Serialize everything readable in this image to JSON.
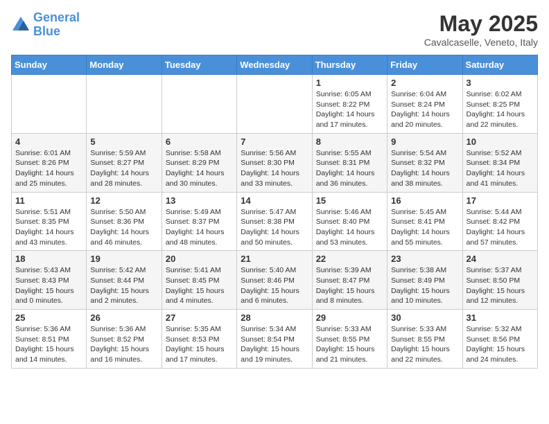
{
  "logo": {
    "line1": "General",
    "line2": "Blue"
  },
  "title": "May 2025",
  "location": "Cavalcaselle, Veneto, Italy",
  "weekdays": [
    "Sunday",
    "Monday",
    "Tuesday",
    "Wednesday",
    "Thursday",
    "Friday",
    "Saturday"
  ],
  "weeks": [
    [
      {
        "day": "",
        "info": ""
      },
      {
        "day": "",
        "info": ""
      },
      {
        "day": "",
        "info": ""
      },
      {
        "day": "",
        "info": ""
      },
      {
        "day": "1",
        "info": "Sunrise: 6:05 AM\nSunset: 8:22 PM\nDaylight: 14 hours\nand 17 minutes."
      },
      {
        "day": "2",
        "info": "Sunrise: 6:04 AM\nSunset: 8:24 PM\nDaylight: 14 hours\nand 20 minutes."
      },
      {
        "day": "3",
        "info": "Sunrise: 6:02 AM\nSunset: 8:25 PM\nDaylight: 14 hours\nand 22 minutes."
      }
    ],
    [
      {
        "day": "4",
        "info": "Sunrise: 6:01 AM\nSunset: 8:26 PM\nDaylight: 14 hours\nand 25 minutes."
      },
      {
        "day": "5",
        "info": "Sunrise: 5:59 AM\nSunset: 8:27 PM\nDaylight: 14 hours\nand 28 minutes."
      },
      {
        "day": "6",
        "info": "Sunrise: 5:58 AM\nSunset: 8:29 PM\nDaylight: 14 hours\nand 30 minutes."
      },
      {
        "day": "7",
        "info": "Sunrise: 5:56 AM\nSunset: 8:30 PM\nDaylight: 14 hours\nand 33 minutes."
      },
      {
        "day": "8",
        "info": "Sunrise: 5:55 AM\nSunset: 8:31 PM\nDaylight: 14 hours\nand 36 minutes."
      },
      {
        "day": "9",
        "info": "Sunrise: 5:54 AM\nSunset: 8:32 PM\nDaylight: 14 hours\nand 38 minutes."
      },
      {
        "day": "10",
        "info": "Sunrise: 5:52 AM\nSunset: 8:34 PM\nDaylight: 14 hours\nand 41 minutes."
      }
    ],
    [
      {
        "day": "11",
        "info": "Sunrise: 5:51 AM\nSunset: 8:35 PM\nDaylight: 14 hours\nand 43 minutes."
      },
      {
        "day": "12",
        "info": "Sunrise: 5:50 AM\nSunset: 8:36 PM\nDaylight: 14 hours\nand 46 minutes."
      },
      {
        "day": "13",
        "info": "Sunrise: 5:49 AM\nSunset: 8:37 PM\nDaylight: 14 hours\nand 48 minutes."
      },
      {
        "day": "14",
        "info": "Sunrise: 5:47 AM\nSunset: 8:38 PM\nDaylight: 14 hours\nand 50 minutes."
      },
      {
        "day": "15",
        "info": "Sunrise: 5:46 AM\nSunset: 8:40 PM\nDaylight: 14 hours\nand 53 minutes."
      },
      {
        "day": "16",
        "info": "Sunrise: 5:45 AM\nSunset: 8:41 PM\nDaylight: 14 hours\nand 55 minutes."
      },
      {
        "day": "17",
        "info": "Sunrise: 5:44 AM\nSunset: 8:42 PM\nDaylight: 14 hours\nand 57 minutes."
      }
    ],
    [
      {
        "day": "18",
        "info": "Sunrise: 5:43 AM\nSunset: 8:43 PM\nDaylight: 15 hours\nand 0 minutes."
      },
      {
        "day": "19",
        "info": "Sunrise: 5:42 AM\nSunset: 8:44 PM\nDaylight: 15 hours\nand 2 minutes."
      },
      {
        "day": "20",
        "info": "Sunrise: 5:41 AM\nSunset: 8:45 PM\nDaylight: 15 hours\nand 4 minutes."
      },
      {
        "day": "21",
        "info": "Sunrise: 5:40 AM\nSunset: 8:46 PM\nDaylight: 15 hours\nand 6 minutes."
      },
      {
        "day": "22",
        "info": "Sunrise: 5:39 AM\nSunset: 8:47 PM\nDaylight: 15 hours\nand 8 minutes."
      },
      {
        "day": "23",
        "info": "Sunrise: 5:38 AM\nSunset: 8:49 PM\nDaylight: 15 hours\nand 10 minutes."
      },
      {
        "day": "24",
        "info": "Sunrise: 5:37 AM\nSunset: 8:50 PM\nDaylight: 15 hours\nand 12 minutes."
      }
    ],
    [
      {
        "day": "25",
        "info": "Sunrise: 5:36 AM\nSunset: 8:51 PM\nDaylight: 15 hours\nand 14 minutes."
      },
      {
        "day": "26",
        "info": "Sunrise: 5:36 AM\nSunset: 8:52 PM\nDaylight: 15 hours\nand 16 minutes."
      },
      {
        "day": "27",
        "info": "Sunrise: 5:35 AM\nSunset: 8:53 PM\nDaylight: 15 hours\nand 17 minutes."
      },
      {
        "day": "28",
        "info": "Sunrise: 5:34 AM\nSunset: 8:54 PM\nDaylight: 15 hours\nand 19 minutes."
      },
      {
        "day": "29",
        "info": "Sunrise: 5:33 AM\nSunset: 8:55 PM\nDaylight: 15 hours\nand 21 minutes."
      },
      {
        "day": "30",
        "info": "Sunrise: 5:33 AM\nSunset: 8:55 PM\nDaylight: 15 hours\nand 22 minutes."
      },
      {
        "day": "31",
        "info": "Sunrise: 5:32 AM\nSunset: 8:56 PM\nDaylight: 15 hours\nand 24 minutes."
      }
    ]
  ]
}
